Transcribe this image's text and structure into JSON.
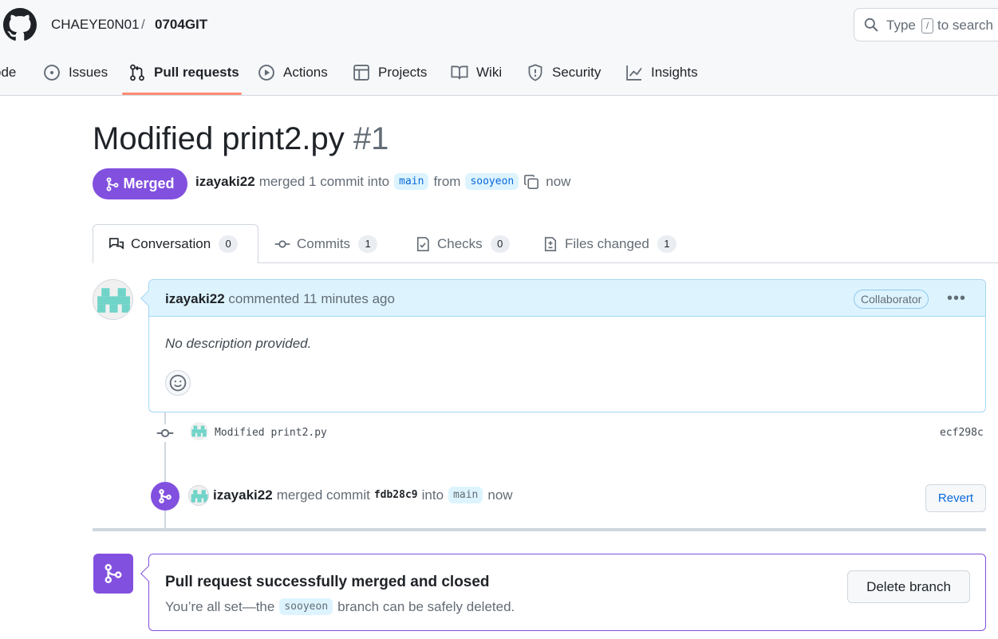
{
  "header": {
    "owner": "CHAEYE0N01",
    "separator": "/",
    "repo": "0704GIT",
    "search_prefix": "Type",
    "search_key": "/",
    "search_suffix": "to search"
  },
  "nav": [
    {
      "label": "ode",
      "icon": "code-icon"
    },
    {
      "label": "Issues",
      "icon": "issue-icon"
    },
    {
      "label": "Pull requests",
      "icon": "pull-request-icon",
      "active": true
    },
    {
      "label": "Actions",
      "icon": "play-icon"
    },
    {
      "label": "Projects",
      "icon": "table-icon"
    },
    {
      "label": "Wiki",
      "icon": "book-icon"
    },
    {
      "label": "Security",
      "icon": "shield-icon"
    },
    {
      "label": "Insights",
      "icon": "graph-icon"
    }
  ],
  "pr": {
    "title": "Modified print2.py",
    "number": "#1",
    "state": "Merged",
    "author": "izayaki22",
    "action_text": "merged 1 commit into",
    "base_branch": "main",
    "from_text": "from",
    "head_branch": "sooyeon",
    "time": "now"
  },
  "tabs": [
    {
      "label": "Conversation",
      "count": "0",
      "icon": "comment-discussion-icon"
    },
    {
      "label": "Commits",
      "count": "1",
      "icon": "commit-icon"
    },
    {
      "label": "Checks",
      "count": "0",
      "icon": "checklist-icon"
    },
    {
      "label": "Files changed",
      "count": "1",
      "icon": "file-diff-icon"
    }
  ],
  "comment": {
    "author": "izayaki22",
    "action": "commented 11 minutes ago",
    "role": "Collaborator",
    "body": "No description provided."
  },
  "commit": {
    "message": "Modified print2.py",
    "sha": "ecf298c"
  },
  "merge_event": {
    "author": "izayaki22",
    "text1": "merged commit",
    "sha": "fdb28c9",
    "text2": "into",
    "branch": "main",
    "time": "now",
    "revert_label": "Revert"
  },
  "merge_status": {
    "title": "Pull request successfully merged and closed",
    "sub_prefix": "You’re all set—the",
    "branch": "sooyeon",
    "sub_suffix": "branch can be safely deleted.",
    "delete_label": "Delete branch"
  },
  "colors": {
    "merged_purple": "#8250df",
    "link_blue": "#0969da",
    "active_underline": "#fd8c73",
    "comment_header_bg": "#ddf4ff"
  }
}
